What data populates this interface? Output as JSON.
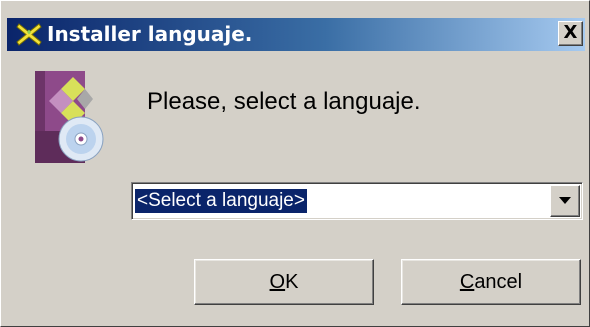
{
  "window": {
    "title": "Installer languaje.",
    "close_label": "X"
  },
  "dialog": {
    "prompt": "Please, select a languaje.",
    "language_select": {
      "selected_value": "<Select a languaje>"
    },
    "buttons": {
      "ok_label": "OK",
      "ok_accel": "O",
      "ok_rest": "K",
      "cancel_label": "Cancel",
      "cancel_accel": "C",
      "cancel_rest": "ancel"
    }
  },
  "icons": {
    "title_icon": "installer-x-icon",
    "app_icon": "install-package-cd-icon",
    "dropdown_arrow": "chevron-down-icon"
  },
  "colors": {
    "titlebar_start": "#0a246a",
    "titlebar_end": "#a6caf0",
    "window_bg": "#d4d0c8",
    "selection_bg": "#0a246a"
  }
}
